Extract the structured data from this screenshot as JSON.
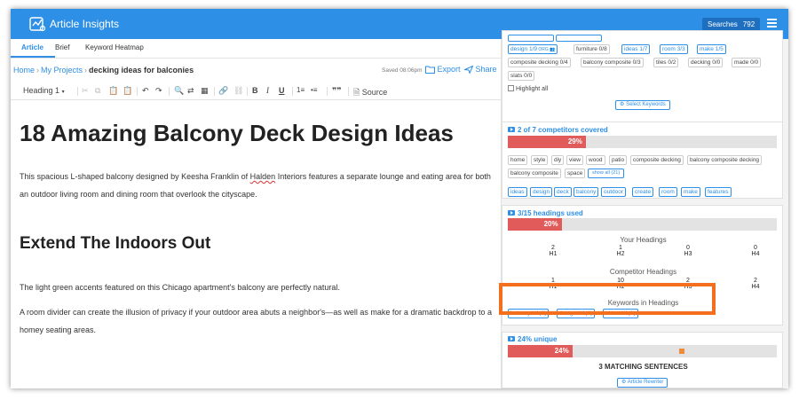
{
  "app": {
    "title": "Article Insights",
    "searches_label": "Searches",
    "searches_count": "792"
  },
  "tabs": [
    {
      "label": "Article"
    },
    {
      "label": "Brief"
    },
    {
      "label": "Keyword Heatmap"
    }
  ],
  "breadcrumb": {
    "home": "Home",
    "projects": "My Projects",
    "current": "decking ideas for balconies"
  },
  "status": {
    "saved": "Saved 08:06pm",
    "export": "Export",
    "share": "Share"
  },
  "toolbar": {
    "heading": "Heading 1",
    "source": "Source"
  },
  "doc": {
    "h1": "18 Amazing Balcony Deck Design Ideas",
    "p1_pre": "This spacious L-shaped balcony designed by Keesha Franklin of ",
    "p1_err": "Halden",
    "p1_post": " Interiors features a separate lounge and eating area for both an outdoor living room and dining room that overlook the cityscape.",
    "h2": "Extend The Indoors Out",
    "p2": "The light green accents featured on this Chicago apartment's balcony are perfectly natural.",
    "p3": "A room divider can create the illusion of privacy if your outdoor area abuts a neighbor's—as well as make for a dramatic backdrop to a homey seating areas."
  },
  "keywords_card": {
    "chips_row1": [
      "design 1/9",
      "furniture 0/8",
      "ideas 1/7",
      "room 3/3",
      "make 1/5"
    ],
    "chips_row2": [
      "composite decking 0/4",
      "balcony composite 0/3",
      "tiles 0/2",
      "decking 0/0",
      "made 0/0"
    ],
    "chips_row3": [
      "slats 0/0"
    ],
    "highlight_all": "Highlight all",
    "select_keywords": "Select Keywords"
  },
  "competitors_card": {
    "title": "2 of 7 competitors covered",
    "percent": 29,
    "percent_label": "29%",
    "terms_row1": [
      "home",
      "style",
      "diy",
      "view",
      "wood",
      "patio",
      "composite decking",
      "balcony composite decking"
    ],
    "terms_row2": [
      "balcony composite",
      "space"
    ],
    "show_all": "show all (21)",
    "keywords": [
      "ideas",
      "design",
      "deck",
      "balcony",
      "outdoor",
      "create",
      "room",
      "make",
      "features"
    ]
  },
  "headings_card": {
    "title": "3/15 headings used",
    "percent": 20,
    "percent_label": "20%",
    "your_headings_label": "Your Headings",
    "your_headings": [
      {
        "count": "2",
        "tag": "H1"
      },
      {
        "count": "1",
        "tag": "H2"
      },
      {
        "count": "0",
        "tag": "H3"
      },
      {
        "count": "0",
        "tag": "H4"
      }
    ],
    "competitor_headings_label": "Competitor Headings",
    "competitor_headings": [
      {
        "count": "1",
        "tag": "H1"
      },
      {
        "count": "10",
        "tag": "H2"
      },
      {
        "count": "2",
        "tag": "H3"
      },
      {
        "count": "2",
        "tag": "H4"
      }
    ],
    "keywords_in_headings_label": "Keywords in Headings",
    "keywords_in_headings": [
      "balcony  H1(1)",
      "design  H1(1)",
      "ideas  H1(1)"
    ]
  },
  "unique_card": {
    "title": "24% unique",
    "percent": 24,
    "percent_label": "24%",
    "matching_sentences": "3 MATCHING SENTENCES",
    "article_rewriter": "Article Rewriter"
  },
  "colors": {
    "accent": "#2d8fe6",
    "bar_fill": "#e25b5b",
    "highlight": "#f36f1e"
  }
}
